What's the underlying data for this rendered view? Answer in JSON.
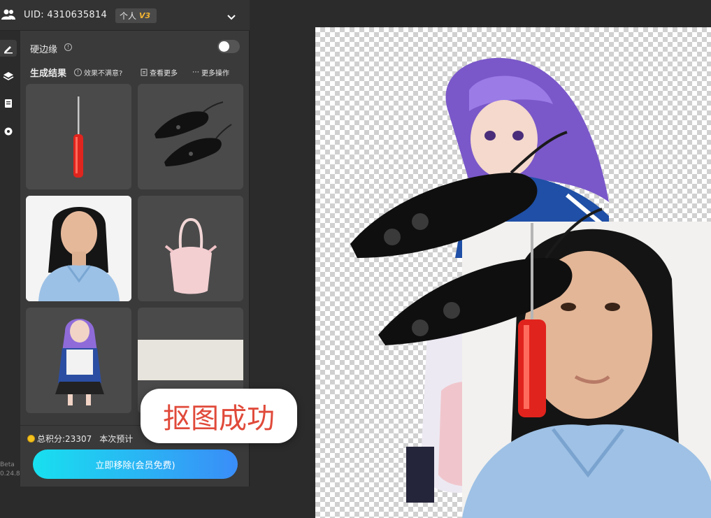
{
  "header": {
    "uid_label": "UID:",
    "uid_value": "4310635814",
    "plan_label": "个人",
    "plan_tier": "V3"
  },
  "settings": {
    "hard_edge_label": "硬边缘",
    "hard_edge_enabled": false
  },
  "results": {
    "title": "生成结果",
    "hint": "效果不满意?",
    "view_more": "查看更多",
    "more_ops": "更多操作",
    "thumbnails": [
      {
        "icon": "screwdriver"
      },
      {
        "icon": "black-mouse-shoes"
      },
      {
        "icon": "woman-portrait"
      },
      {
        "icon": "pink-handbag"
      },
      {
        "icon": "anime-girl"
      },
      {
        "icon": "blank-paper"
      }
    ]
  },
  "footer": {
    "points_label": "总积分:23307",
    "estimate_label": "本次预计",
    "cta_label": "立即移除(会员免费)"
  },
  "rail": {
    "beta_label": "Beta",
    "version": "0.24.8"
  },
  "toast": {
    "message": "抠图成功"
  },
  "colors": {
    "accent_gradient_start": "#18e0ef",
    "accent_gradient_end": "#3a8df8",
    "toast_text": "#e04a3a",
    "tier_badge": "#f3b431"
  }
}
